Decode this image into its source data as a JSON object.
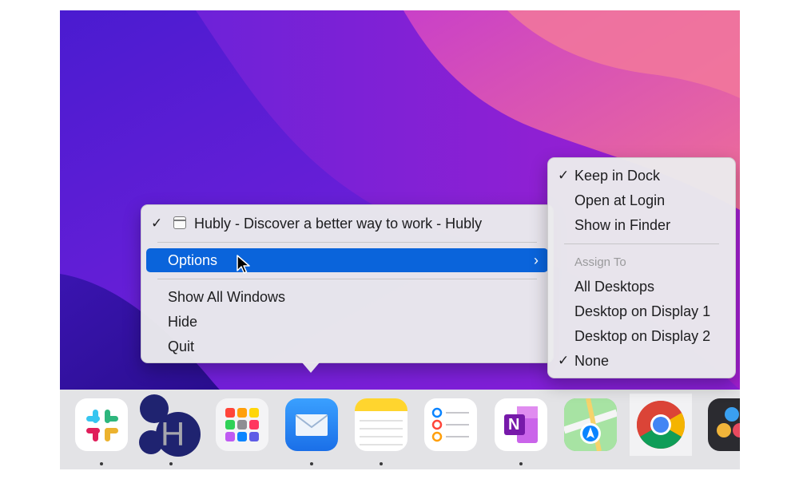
{
  "context_menu": {
    "window_title": "Hubly - Discover a better way to work - Hubly",
    "options_label": "Options",
    "options_chevron": "›",
    "show_all_windows": "Show All Windows",
    "hide": "Hide",
    "quit": "Quit",
    "checkmark": "✓"
  },
  "options_submenu": {
    "keep_in_dock": "Keep in Dock",
    "open_at_login": "Open at Login",
    "show_in_finder": "Show in Finder",
    "assign_to_header": "Assign To",
    "all_desktops": "All Desktops",
    "desktop_display_1": "Desktop on Display 1",
    "desktop_display_2": "Desktop on Display 2",
    "none": "None",
    "checkmark": "✓"
  },
  "dock": {
    "hubly_letter": "H",
    "onenote_letter": "N",
    "items": [
      "slack-icon",
      "hubly-icon",
      "launchpad-icon",
      "mail-icon",
      "notes-icon",
      "reminders-icon",
      "onenote-icon",
      "maps-icon",
      "chrome-icon",
      "davinci-resolve-icon"
    ]
  },
  "colors": {
    "selection": "#0a64db",
    "wallpaper_primary": "#6a1fd0",
    "wallpaper_accent": "#e0559a"
  }
}
